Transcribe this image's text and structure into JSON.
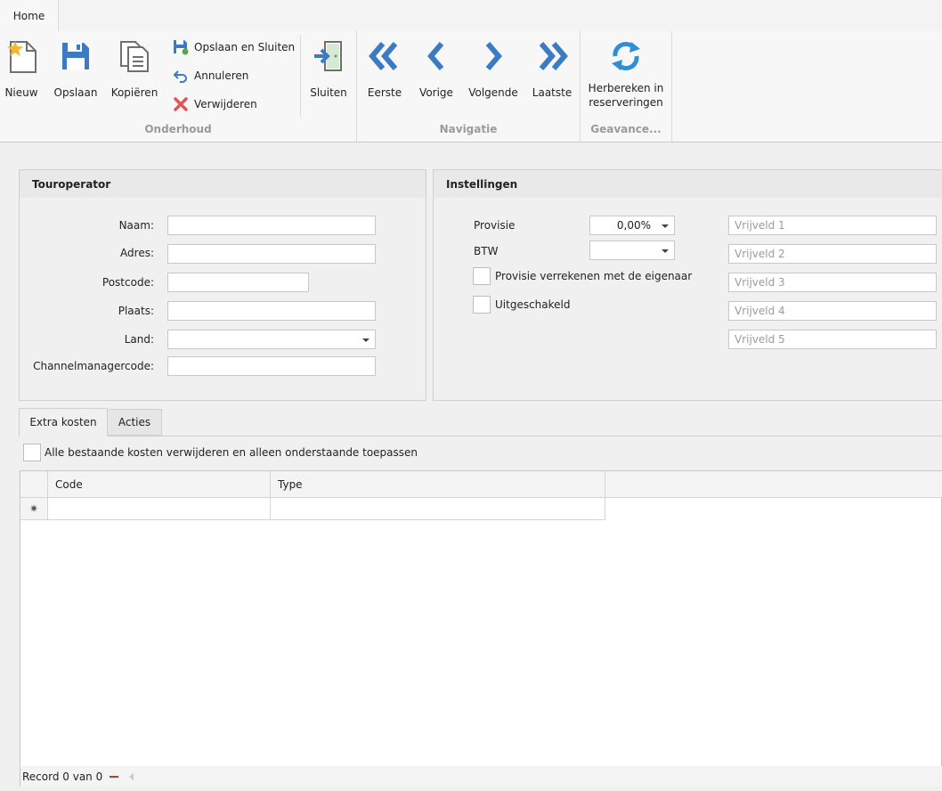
{
  "ribbon": {
    "tab": "Home",
    "buttons": {
      "nieuw": "Nieuw",
      "opslaan": "Opslaan",
      "kopieren": "Kopiëren",
      "opslaan_en_sluiten": "Opslaan en Sluiten",
      "annuleren": "Annuleren",
      "verwijderen": "Verwijderen",
      "sluiten": "Sluiten",
      "eerste": "Eerste",
      "vorige": "Vorige",
      "volgende": "Volgende",
      "laatste": "Laatste",
      "herbereken_line1": "Herbereken in",
      "herbereken_line2": "reserveringen"
    },
    "groups": {
      "onderhoud": "Onderhoud",
      "navigatie": "Navigatie",
      "geavanceerd": "Geavance..."
    },
    "colors": {
      "accent_blue": "#3b7bc4",
      "delete_red": "#e0535a",
      "star_yellow": "#f2b632"
    }
  },
  "touroperator": {
    "title": "Touroperator",
    "labels": {
      "naam": "Naam:",
      "adres": "Adres:",
      "postcode": "Postcode:",
      "plaats": "Plaats:",
      "land": "Land:",
      "channelmanagercode": "Channelmanagercode:"
    },
    "values": {
      "naam": "",
      "adres": "",
      "postcode": "",
      "plaats": "",
      "land": "",
      "channelmanagercode": ""
    }
  },
  "instellingen": {
    "title": "Instellingen",
    "provisie_label": "Provisie",
    "provisie_value": "0,00%",
    "btw_label": "BTW",
    "btw_value": "",
    "provisie_verrekenen_label": "Provisie verrekenen met de eigenaar",
    "provisie_verrekenen_checked": false,
    "uitgeschakeld_label": "Uitgeschakeld",
    "uitgeschakeld_checked": false,
    "vrijvelden": [
      "Vrijveld 1",
      "Vrijveld 2",
      "Vrijveld 3",
      "Vrijveld 4",
      "Vrijveld 5"
    ]
  },
  "tabs": {
    "extra_kosten": "Extra kosten",
    "acties": "Acties",
    "active": "Extra kosten"
  },
  "extra_kosten": {
    "remove_existing_label": "Alle bestaande kosten verwijderen en alleen onderstaande toepassen",
    "remove_existing_checked": false,
    "columns": [
      "Code",
      "Type"
    ],
    "rows": [],
    "new_row_glyph": "✷",
    "record_text": "Record 0 van 0"
  }
}
